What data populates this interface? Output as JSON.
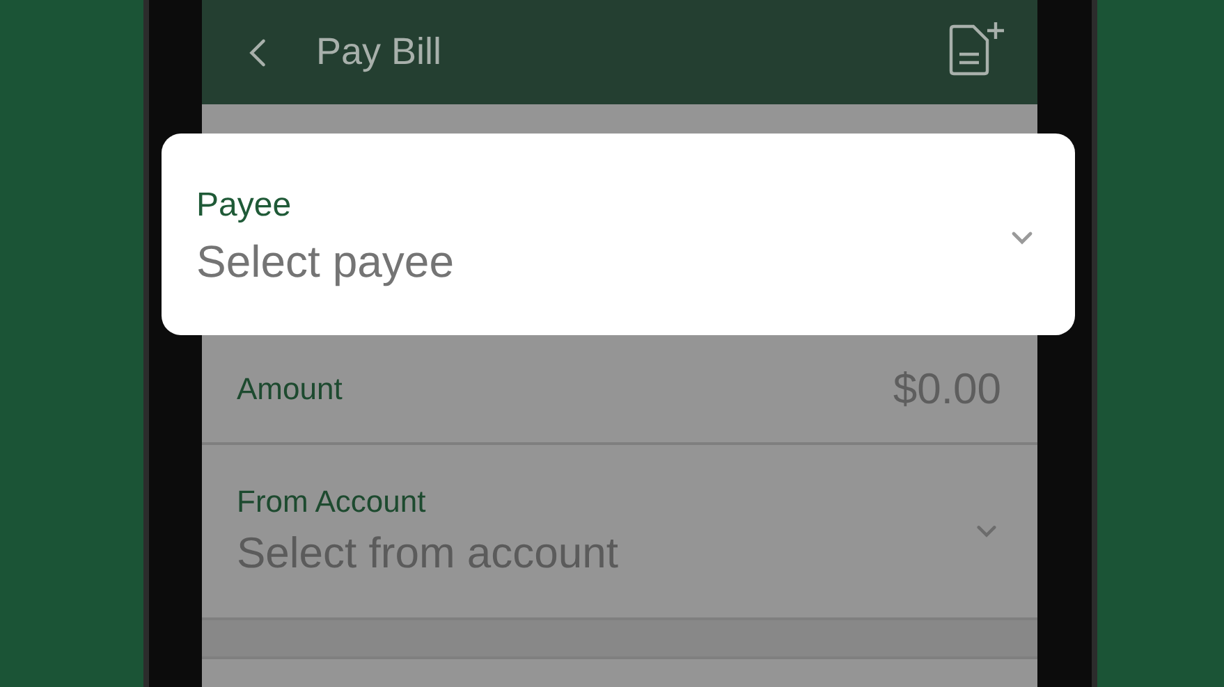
{
  "header": {
    "title": "Pay Bill"
  },
  "payee": {
    "label": "Payee",
    "placeholder": "Select payee"
  },
  "fields": [
    {
      "kind": "amount",
      "label": "Amount",
      "value": "$0.00"
    },
    {
      "kind": "select",
      "label": "From Account",
      "placeholder": "Select from account"
    }
  ]
}
